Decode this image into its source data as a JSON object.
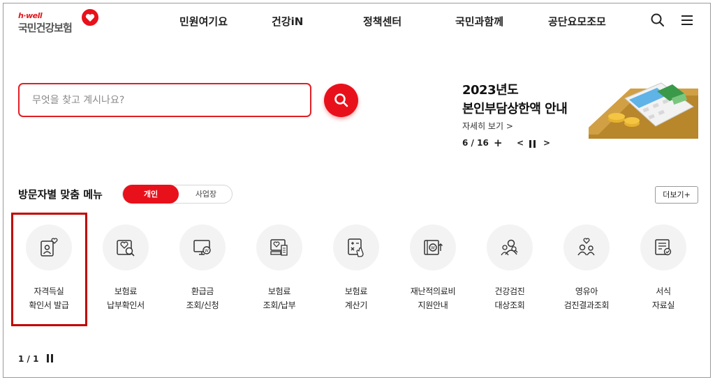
{
  "logo": {
    "small": "h·well",
    "main": "국민건강보험"
  },
  "nav": {
    "items": [
      {
        "label": "민원여기요"
      },
      {
        "label": "건강iN"
      },
      {
        "label": "정책센터"
      },
      {
        "label": "국민과함께"
      },
      {
        "label": "공단요모조모"
      }
    ]
  },
  "search": {
    "placeholder": "무엇을 찾고 계시나요?"
  },
  "banner": {
    "title_line1": "2023년도",
    "title_line2": "본인부담상한액 안내",
    "link": "자세히 보기 >",
    "counter": "6 / 16",
    "plus": "+",
    "prev": "<",
    "next": ">"
  },
  "custom_menu": {
    "title": "방문자별 맞춤 메뉴",
    "tabs": {
      "personal": "개인",
      "business": "사업장"
    },
    "more": "더보기+",
    "items": [
      {
        "line1": "자격득실",
        "line2": "확인서 발급",
        "icon": "qualification-icon"
      },
      {
        "line1": "보험료",
        "line2": "납부확인서",
        "icon": "payment-certificate-icon"
      },
      {
        "line1": "환급금",
        "line2": "조회/신청",
        "icon": "refund-monitor-icon"
      },
      {
        "line1": "보험료",
        "line2": "조회/납부",
        "icon": "premium-receipt-icon"
      },
      {
        "line1": "보험료",
        "line2": "계산기",
        "icon": "calculator-icon"
      },
      {
        "line1": "재난적의료비",
        "line2": "지원안내",
        "icon": "medical-support-icon"
      },
      {
        "line1": "건강검진",
        "line2": "대상조회",
        "icon": "checkup-people-icon"
      },
      {
        "line1": "영유아",
        "line2": "검진결과조회",
        "icon": "infant-checkup-icon"
      },
      {
        "line1": "서식",
        "line2": "자료실",
        "icon": "forms-library-icon"
      }
    ],
    "pager": "1 / 1"
  },
  "colors": {
    "accent": "#e8111b",
    "highlight": "#c00000"
  }
}
